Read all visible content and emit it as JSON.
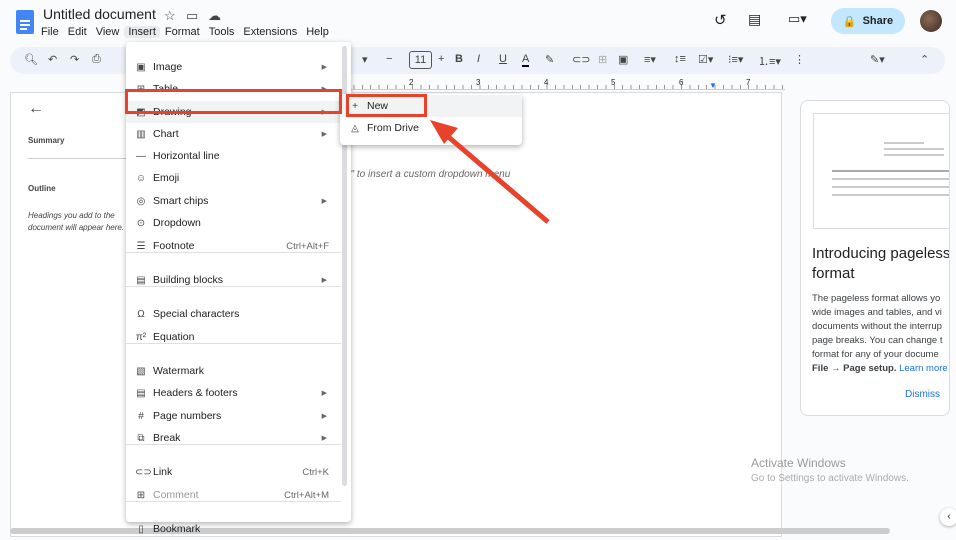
{
  "header": {
    "title": "Untitled document",
    "share": "Share",
    "menus": [
      "File",
      "Edit",
      "View",
      "Insert",
      "Format",
      "Tools",
      "Extensions",
      "Help"
    ]
  },
  "toolbar": {
    "font_size": "11"
  },
  "ruler": [
    "2",
    "3",
    "4",
    "5",
    "6",
    "7"
  ],
  "sidebar": {
    "summary": "Summary",
    "outline": "Outline",
    "outline_hint": "Headings you add to the document will appear here."
  },
  "document": {
    "hint": "n\" to insert a custom dropdown menu"
  },
  "insert_menu": {
    "items": [
      {
        "label": "Image",
        "icon": "image-icon",
        "arrow": true
      },
      {
        "label": "Table",
        "icon": "table-icon",
        "arrow": true
      },
      {
        "label": "Drawing",
        "icon": "drawing-icon",
        "arrow": true,
        "highlighted": true
      },
      {
        "label": "Chart",
        "icon": "chart-icon",
        "arrow": true
      },
      {
        "label": "Horizontal line",
        "icon": "horizontal-line-icon"
      },
      {
        "label": "Emoji",
        "icon": "emoji-icon"
      },
      {
        "label": "Smart chips",
        "icon": "smart-chips-icon",
        "arrow": true
      },
      {
        "label": "Dropdown",
        "icon": "dropdown-icon"
      },
      {
        "label": "Footnote",
        "icon": "footnote-icon",
        "shortcut": "Ctrl+Alt+F"
      },
      {
        "label": "Building blocks",
        "icon": "building-blocks-icon",
        "arrow": true
      },
      {
        "label": "Special characters",
        "icon": "omega-icon"
      },
      {
        "label": "Equation",
        "icon": "pi-icon"
      },
      {
        "label": "Watermark",
        "icon": "watermark-icon"
      },
      {
        "label": "Headers & footers",
        "icon": "headers-icon",
        "arrow": true
      },
      {
        "label": "Page numbers",
        "icon": "hash-icon",
        "arrow": true
      },
      {
        "label": "Break",
        "icon": "break-icon",
        "arrow": true
      },
      {
        "label": "Link",
        "icon": "link-icon",
        "shortcut": "Ctrl+K"
      },
      {
        "label": "Comment",
        "icon": "comment-icon",
        "shortcut": "Ctrl+Alt+M",
        "disabled": true
      },
      {
        "label": "Bookmark",
        "icon": "bookmark-icon"
      }
    ]
  },
  "drawing_submenu": {
    "items": [
      {
        "label": "New",
        "icon": "plus-icon"
      },
      {
        "label": "From Drive",
        "icon": "drive-icon"
      }
    ]
  },
  "card": {
    "title": "Introducing pageless format",
    "body": [
      "The pageless format allows yo",
      "wide images and tables, and vi",
      "documents without the interrup",
      "page breaks. You can change t",
      "format for any of your docume"
    ],
    "path": "File → Page setup.",
    "learn_more": "Learn more",
    "dismiss": "Dismiss"
  },
  "watermark": {
    "line1": "Activate Windows",
    "line2": "Go to Settings to activate Windows."
  },
  "colors": {
    "highlight_box": "#e8432a",
    "share_bg": "#c2e7ff",
    "accent": "#1a73e8"
  }
}
